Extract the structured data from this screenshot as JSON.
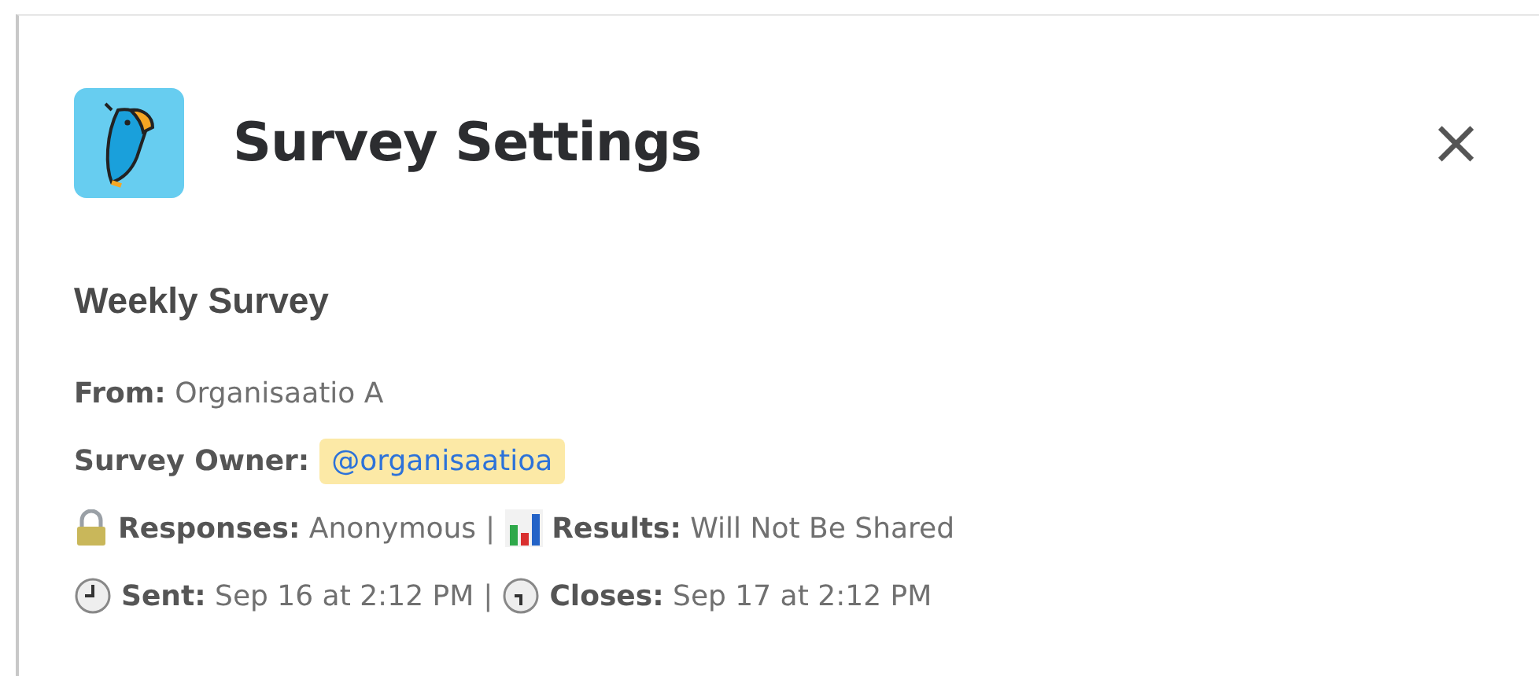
{
  "dialog": {
    "title": "Survey Settings",
    "close": "×"
  },
  "survey": {
    "name": "Weekly Survey",
    "rows": [
      {
        "kind": "plain",
        "text": "**From:** Organisaatio A"
      },
      {
        "kind": "mention",
        "label": "Survey Owner:",
        "mention": "@organisaatioa"
      },
      {
        "kind": "pair",
        "separator": "|",
        "items": [
          {
            "text": "**Responses:** Anonymous"
          },
          {
            "text": "**Results:** Will Not Be Shared"
          }
        ]
      },
      {
        "kind": "pair",
        "separator": "|",
        "items": [
          {
            "text": "**Sent:** Sep 16 at 2:12 PM"
          },
          {
            "text": "**Closes:** Sep 17 at 2:12 PM"
          }
        ]
      }
    ]
  }
}
